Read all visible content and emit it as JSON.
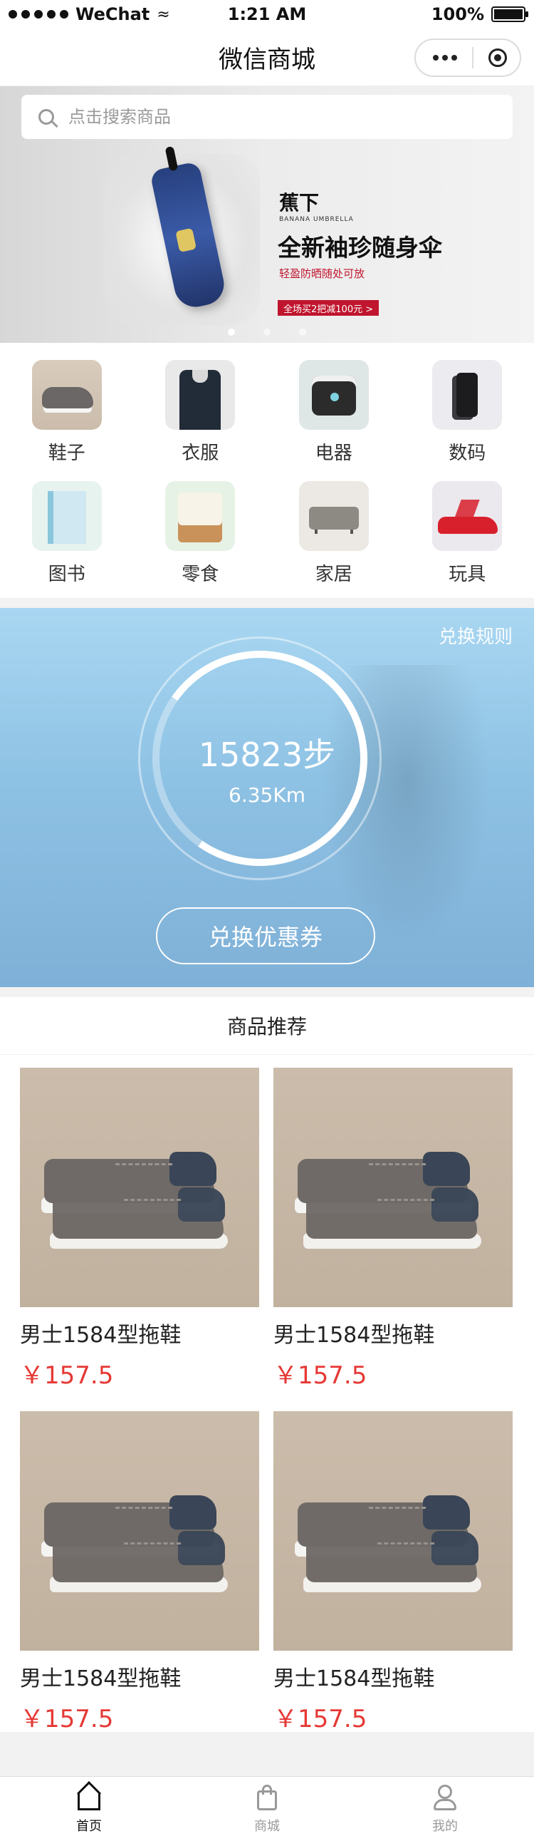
{
  "status_bar": {
    "carrier": "WeChat",
    "time": "1:21 AM",
    "battery": "100%"
  },
  "nav": {
    "title": "微信商城"
  },
  "search": {
    "placeholder": "点击搜索商品"
  },
  "banner": {
    "brand": "蕉下",
    "brand_en": "BANANA UMBRELLA",
    "title": "全新袖珍随身伞",
    "subtitle": "轻盈防晒随处可放",
    "tag": "全场买2把减100元 >",
    "active_slide": 1,
    "slides": 3
  },
  "categories": [
    {
      "label": "鞋子",
      "icon": "shoe-icon"
    },
    {
      "label": "衣服",
      "icon": "clothes-icon"
    },
    {
      "label": "电器",
      "icon": "appliance-icon"
    },
    {
      "label": "数码",
      "icon": "phone-icon"
    },
    {
      "label": "图书",
      "icon": "book-icon"
    },
    {
      "label": "零食",
      "icon": "snack-icon"
    },
    {
      "label": "家居",
      "icon": "sofa-icon"
    },
    {
      "label": "玩具",
      "icon": "toy-car-icon"
    }
  ],
  "steps": {
    "rules_link": "兑换规则",
    "count": "15823步",
    "distance": "6.35Km",
    "button": "兑换优惠券"
  },
  "recommend": {
    "title": "商品推荐",
    "products": [
      {
        "name": "男士1584型拖鞋",
        "price": "￥157.5"
      },
      {
        "name": "男士1584型拖鞋",
        "price": "￥157.5"
      },
      {
        "name": "男士1584型拖鞋",
        "price": "￥157.5"
      },
      {
        "name": "男士1584型拖鞋",
        "price": "￥157.5"
      }
    ]
  },
  "tabbar": {
    "tabs": [
      {
        "label": "首页",
        "icon": "home-icon",
        "active": true
      },
      {
        "label": "商城",
        "icon": "shopping-bag-icon",
        "active": false
      },
      {
        "label": "我的",
        "icon": "user-icon",
        "active": false
      }
    ]
  },
  "colors": {
    "price": "#e53935",
    "banner_tag": "#c0152e",
    "steps_bg": "#8ec2e4"
  }
}
